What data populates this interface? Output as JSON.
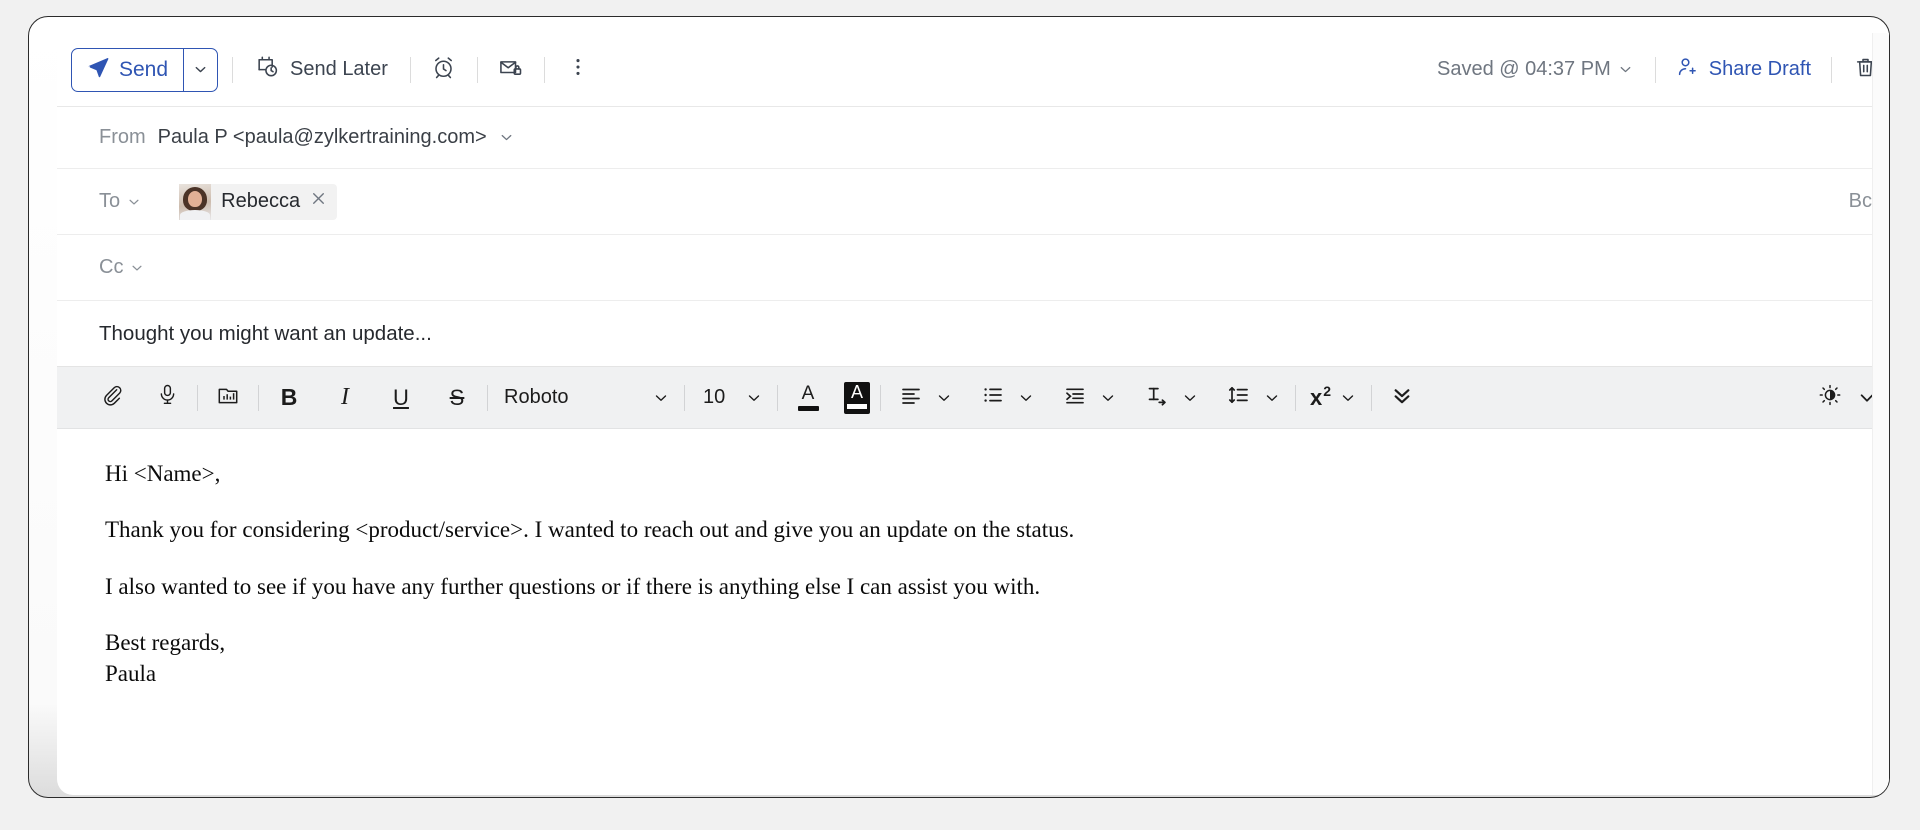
{
  "action_bar": {
    "send_label": "Send",
    "send_caret_icon": "chevron-down-icon",
    "send_icon": "paper-plane-icon",
    "send_later_label": "Send Later",
    "send_later_icon": "calendar-clock-icon",
    "reminder_icon": "alarm-clock-icon",
    "secure_mail_icon": "envelope-lock-icon",
    "more_options_icon": "vertical-dots-icon",
    "saved_status": "Saved @ 04:37 PM",
    "saved_caret_icon": "chevron-down-icon",
    "share_draft_label": "Share Draft",
    "share_draft_icon": "user-plus-icon",
    "delete_icon": "trash-icon"
  },
  "fields": {
    "from_label": "From",
    "from_value": "Paula P <paula@zylkertraining.com>",
    "from_caret_icon": "chevron-down-icon",
    "to_label": "To",
    "to_caret_icon": "chevron-down-icon",
    "to_recipient": "Rebecca",
    "to_recipient_remove_icon": "close-icon",
    "bcc_label": "Bcc",
    "cc_label": "Cc",
    "cc_caret_icon": "chevron-down-icon",
    "cc_value": "",
    "subject": "Thought you might want an update..."
  },
  "format_bar": {
    "attach_icon": "paperclip-icon",
    "audio_icon": "microphone-icon",
    "insert_image_icon": "insert-image-icon",
    "bold_label": "B",
    "italic_label": "I",
    "underline_label": "U",
    "strikethrough_label": "S",
    "font_family_value": "Roboto",
    "font_size_value": "10",
    "text_color_label": "A",
    "highlight_color_label": "A",
    "align_icon": "align-left-icon",
    "bullet_list_icon": "bulleted-list-icon",
    "indent_icon": "indent-icon",
    "text_direction_icon": "text-direction-icon",
    "line_spacing_icon": "line-spacing-icon",
    "superscript_label": "x",
    "superscript_exponent": "2",
    "more_format_icon": "double-chevron-down-icon",
    "dark_mode_icon": "brightness-contrast-icon",
    "dark_mode_caret_icon": "chevron-down-icon",
    "caret_icon": "chevron-down-icon"
  },
  "body": {
    "paragraphs": [
      "Hi <Name>,",
      "Thank you for considering <product/service>. I wanted to reach out and give you an update on the status.",
      "I also wanted to see if you have any further questions or if there is anything else I can assist you with."
    ],
    "signature_line_1": "Best regards,",
    "signature_line_2": "Paula"
  },
  "colors": {
    "accent_blue": "#2f55b3",
    "page_background": "#f1f1f1",
    "toolbar_background": "#f0f1f2",
    "muted_text": "#8a9097"
  }
}
